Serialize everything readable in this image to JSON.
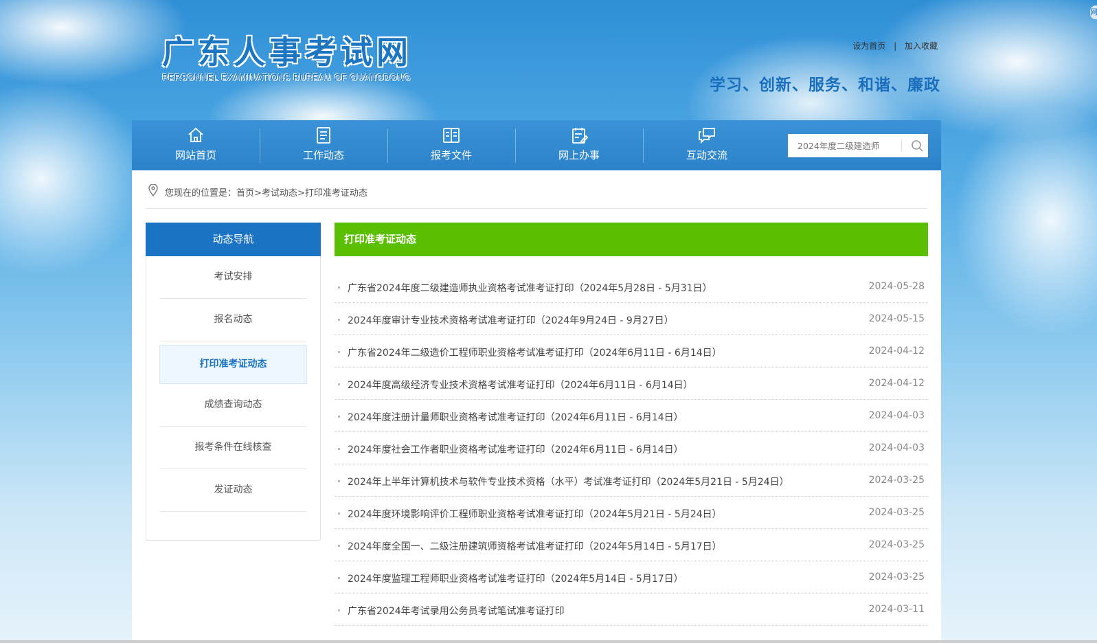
{
  "header": {
    "logo_title": "广东人事考试网",
    "logo_subtitle": "PERSONNEL EXAMINATIONS BUREAU OF GUANGDONG",
    "set_home": "设为首页",
    "link_sep": "|",
    "add_favorite": "加入收藏",
    "slogan": "学习、创新、服务、和谐、廉政",
    "corner_badge": "网"
  },
  "nav": {
    "items": [
      {
        "label": "网站首页",
        "icon": "home-icon"
      },
      {
        "label": "工作动态",
        "icon": "document-list-icon"
      },
      {
        "label": "报考文件",
        "icon": "open-book-icon"
      },
      {
        "label": "网上办事",
        "icon": "clipboard-edit-icon"
      },
      {
        "label": "互动交流",
        "icon": "chat-bubbles-icon"
      }
    ],
    "search_placeholder": "2024年度二级建造师",
    "search_icon": "search-icon"
  },
  "breadcrumb": {
    "prefix": "您现在的位置是：",
    "home": "首页",
    "sep": ">",
    "level1": "考试动态",
    "level2": "打印准考证动态"
  },
  "sidebar": {
    "title": "动态导航",
    "items": [
      {
        "label": "考试安排"
      },
      {
        "label": "报名动态"
      },
      {
        "label": "打印准考证动态",
        "active": true
      },
      {
        "label": "成绩查询动态"
      },
      {
        "label": "报考条件在线核查"
      },
      {
        "label": "发证动态"
      }
    ]
  },
  "main": {
    "title": "打印准考证动态",
    "rows": [
      {
        "title": "广东省2024年度二级建造师执业资格考试准考证打印（2024年5月28日 - 5月31日）",
        "date": "2024-05-28"
      },
      {
        "title": "2024年度审计专业技术资格考试准考证打印（2024年9月24日 - 9月27日）",
        "date": "2024-05-15"
      },
      {
        "title": "广东省2024年二级造价工程师职业资格考试准考证打印（2024年6月11日 - 6月14日）",
        "date": "2024-04-12"
      },
      {
        "title": "2024年度高级经济专业技术资格考试准考证打印（2024年6月11日 - 6月14日）",
        "date": "2024-04-12"
      },
      {
        "title": "2024年度注册计量师职业资格考试准考证打印（2024年6月11日 - 6月14日）",
        "date": "2024-04-03"
      },
      {
        "title": "2024年度社会工作者职业资格考试准考证打印（2024年6月11日 - 6月14日）",
        "date": "2024-04-03"
      },
      {
        "title": "2024年上半年计算机技术与软件专业技术资格（水平）考试准考证打印（2024年5月21日 - 5月24日）",
        "date": "2024-03-25"
      },
      {
        "title": "2024年度环境影响评价工程师职业资格考试准考证打印（2024年5月21日 - 5月24日）",
        "date": "2024-03-25"
      },
      {
        "title": "2024年度全国一、二级注册建筑师资格考试准考证打印（2024年5月14日 - 5月17日）",
        "date": "2024-03-25"
      },
      {
        "title": "2024年度监理工程师职业资格考试准考证打印（2024年5月14日 - 5月17日）",
        "date": "2024-03-25"
      },
      {
        "title": "广东省2024年考试录用公务员考试笔试准考证打印",
        "date": "2024-03-11"
      }
    ]
  },
  "colors": {
    "nav_blue": "#2b82c9",
    "sidebar_head": "#1b73c3",
    "main_head_green": "#5abf00"
  }
}
